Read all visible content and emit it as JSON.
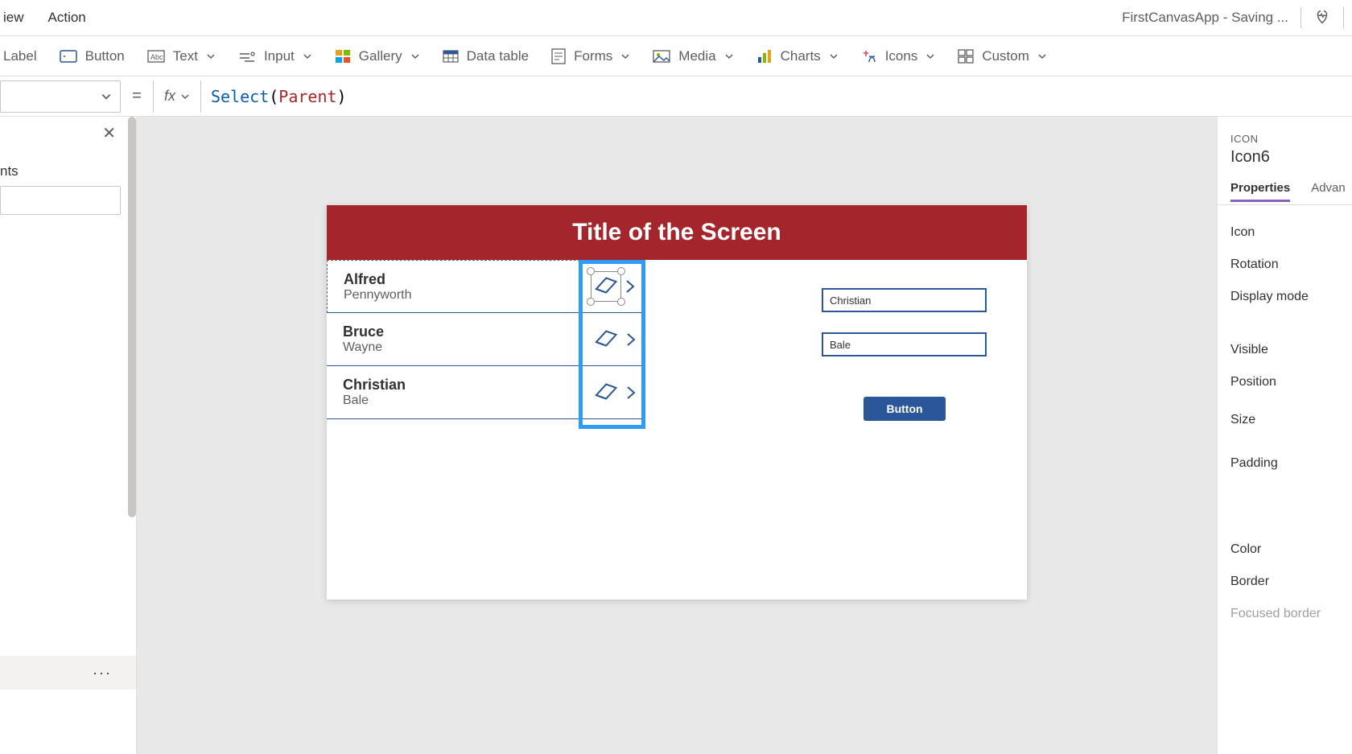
{
  "top_menu": {
    "view": "iew",
    "action": "Action",
    "app_title": "FirstCanvasApp - Saving ..."
  },
  "ribbon": {
    "label": "Label",
    "button": "Button",
    "text": "Text",
    "input": "Input",
    "gallery": "Gallery",
    "datatable": "Data table",
    "forms": "Forms",
    "media": "Media",
    "charts": "Charts",
    "icons": "Icons",
    "custom": "Custom"
  },
  "formula": {
    "eq": "=",
    "fx": "fx",
    "fn": "Select",
    "open": "(",
    "pv": "Parent",
    "close": ")"
  },
  "left": {
    "label": "nts",
    "dots": "···"
  },
  "canvas": {
    "title": "Title of the Screen",
    "rows": [
      {
        "first": "Alfred",
        "last": "Pennyworth"
      },
      {
        "first": "Bruce",
        "last": "Wayne"
      },
      {
        "first": "Christian",
        "last": "Bale"
      }
    ],
    "input1": "Christian",
    "input2": "Bale",
    "button": "Button"
  },
  "right": {
    "category": "ICON",
    "name": "Icon6",
    "tab_props": "Properties",
    "tab_adv": "Advan",
    "props": [
      "Icon",
      "Rotation",
      "Display mode"
    ],
    "props2": [
      "Visible",
      "Position",
      "Size",
      "Padding"
    ],
    "props3": [
      "Color",
      "Border",
      "Focused border"
    ]
  }
}
